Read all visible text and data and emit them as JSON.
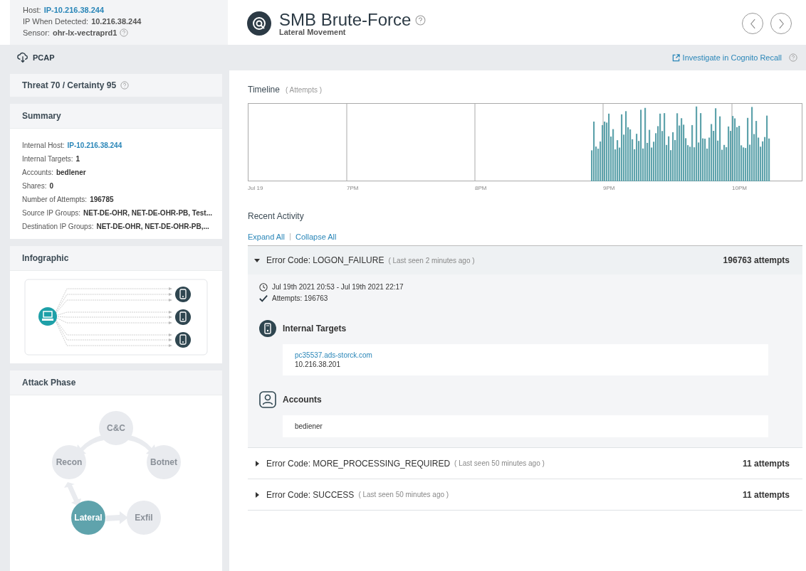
{
  "host_info": {
    "host_label": "Host:",
    "host": "IP-10.216.38.244",
    "ip_label": "IP When Detected:",
    "ip": "10.216.38.244",
    "sensor_label": "Sensor:",
    "sensor": "ohr-lx-vectraprd1"
  },
  "detection": {
    "title": "SMB Brute-Force",
    "subtitle": "Lateral Movement"
  },
  "toolbar": {
    "pcap": "PCAP",
    "investigate": "Investigate in Cognito Recall"
  },
  "score": "Threat 70 / Certainty 95",
  "summary": {
    "title": "Summary",
    "fields": [
      {
        "label": "Internal Host:",
        "value": "IP-10.216.38.244",
        "kind": "link"
      },
      {
        "label": "Internal Targets:",
        "value": "1",
        "kind": "text"
      },
      {
        "label": "Accounts:",
        "value": "bedlener",
        "kind": "text"
      },
      {
        "label": "Shares:",
        "value": "0",
        "kind": "text"
      },
      {
        "label": "Number of Attempts:",
        "value": "196785",
        "kind": "text"
      },
      {
        "label": "Source IP Groups:",
        "value": "NET-DE-OHR, NET-DE-OHR-PB, Test...",
        "kind": "text"
      },
      {
        "label": "Destination IP Groups:",
        "value": "NET-DE-OHR, NET-DE-OHR-PB,...",
        "kind": "text"
      }
    ]
  },
  "infographic": {
    "title": "Infographic"
  },
  "attack_phase": {
    "title": "Attack Phase",
    "phases": [
      {
        "label": "C&C",
        "selected": false
      },
      {
        "label": "Recon",
        "selected": false
      },
      {
        "label": "Botnet",
        "selected": false
      },
      {
        "label": "Lateral",
        "selected": true
      },
      {
        "label": "Exfil",
        "selected": false
      }
    ]
  },
  "timeline": {
    "title": "Timeline",
    "unit": "( Attempts )",
    "x_labels": [
      "Jul 19",
      "7PM",
      "8PM",
      "9PM",
      "10PM"
    ]
  },
  "recent_activity": {
    "title": "Recent Activity",
    "expand_all": "Expand All",
    "collapse_all": "Collapse All",
    "groups": [
      {
        "code": "Error Code: LOGON_FAILURE",
        "last_seen": "( Last seen 2 minutes ago )",
        "count": "196763 attempts",
        "expanded": true,
        "range": "Jul 19th 2021 20:53 - Jul 19th 2021 22:17",
        "attempts": "Attempts: 196763",
        "targets_title": "Internal Targets",
        "targets": [
          {
            "host": "pc35537.ads-storck.com",
            "ip": "10.216.38.201"
          }
        ],
        "accounts_title": "Accounts",
        "accounts": [
          "bediener"
        ]
      },
      {
        "code": "Error Code: MORE_PROCESSING_REQUIRED",
        "last_seen": "( Last seen 50 minutes ago )",
        "count": "11 attempts",
        "expanded": false
      },
      {
        "code": "Error Code: SUCCESS",
        "last_seen": "( Last seen 50 minutes ago )",
        "count": "11 attempts",
        "expanded": false
      }
    ]
  }
}
